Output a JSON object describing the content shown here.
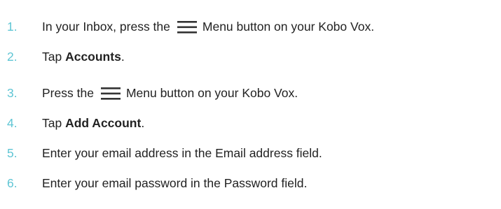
{
  "steps": [
    {
      "number": "1.",
      "before": "In your Inbox, press the",
      "icon": "menu-icon",
      "after": "Menu button on your Kobo Vox."
    },
    {
      "number": "2.",
      "before": "Tap ",
      "bold": "Accounts",
      "after": "."
    },
    {
      "number": "3.",
      "before": "Press the",
      "icon": "menu-icon",
      "after": "Menu button on your Kobo Vox."
    },
    {
      "number": "4.",
      "before": "Tap ",
      "bold": "Add Account",
      "after": "."
    },
    {
      "number": "5.",
      "text": "Enter your email address in the Email address field."
    },
    {
      "number": "6.",
      "text": "Enter your email password in the Password field."
    }
  ],
  "colors": {
    "number": "#5fc5d4",
    "text": "#222222",
    "icon": "#333333"
  }
}
